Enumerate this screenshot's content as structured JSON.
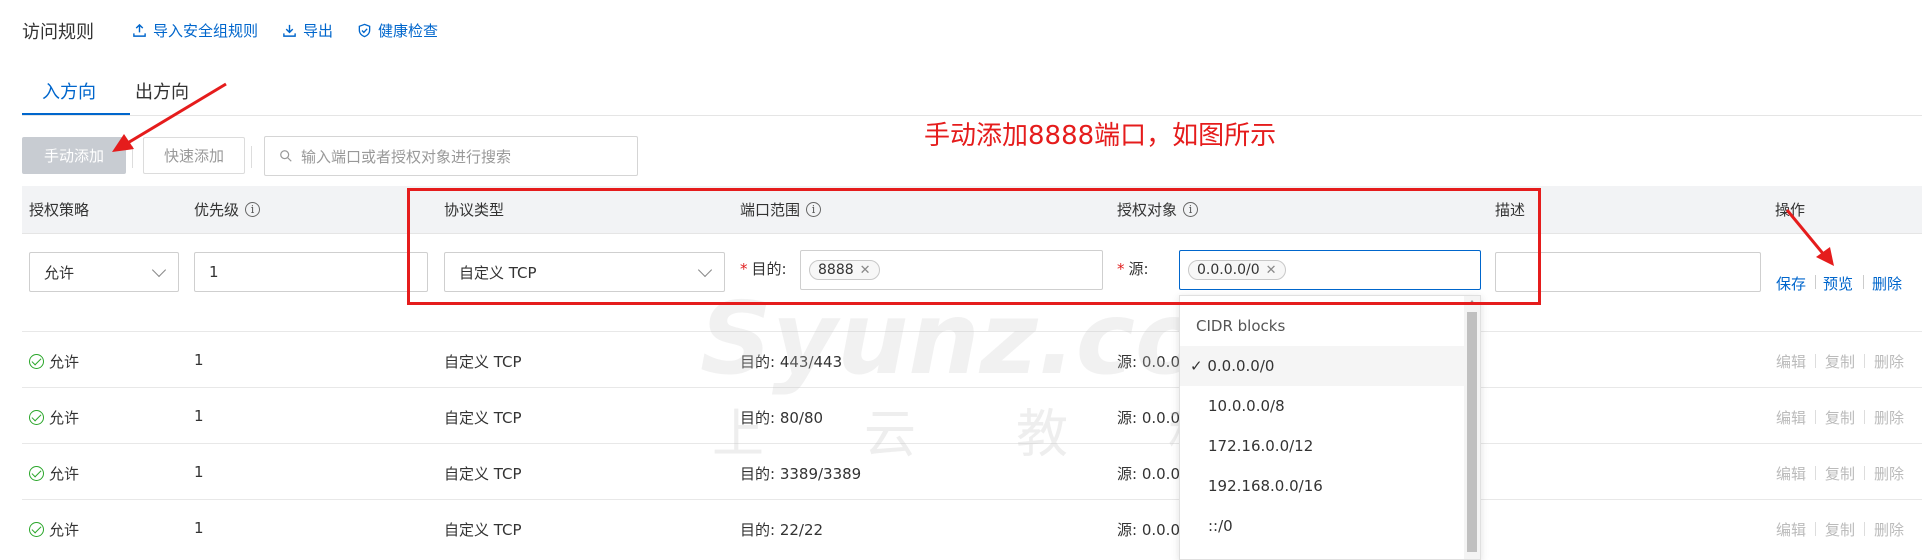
{
  "header": {
    "title": "访问规则",
    "links": [
      {
        "label": "导入安全组规则",
        "icon": "upload-icon"
      },
      {
        "label": "导出",
        "icon": "download-icon"
      },
      {
        "label": "健康检查",
        "icon": "shield-check-icon"
      }
    ]
  },
  "tabs": [
    {
      "label": "入方向",
      "active": true
    },
    {
      "label": "出方向",
      "active": false
    }
  ],
  "toolbar": {
    "manual_add": "手动添加",
    "quick_add": "快速添加",
    "search_placeholder": "输入端口或者授权对象进行搜索"
  },
  "annotation": "手动添加8888端口，如图所示",
  "watermark": {
    "line1": "Syunz.com",
    "line2": "上云教程"
  },
  "table": {
    "headers": {
      "policy": "授权策略",
      "priority": "优先级",
      "protocol": "协议类型",
      "port_range": "端口范围",
      "auth_object": "授权对象",
      "description": "描述",
      "actions": "操作"
    },
    "edit_row": {
      "policy": "允许",
      "priority": "1",
      "protocol": "自定义 TCP",
      "port_label": "目的:",
      "port_tag": "8888",
      "source_label": "源:",
      "source_tag": "0.0.0.0/0",
      "description": "",
      "actions": [
        "保存",
        "预览",
        "删除"
      ]
    },
    "rows": [
      {
        "policy": "允许",
        "priority": "1",
        "protocol": "自定义 TCP",
        "port": "目的: 443/443",
        "source": "源: 0.0.0."
      },
      {
        "policy": "允许",
        "priority": "1",
        "protocol": "自定义 TCP",
        "port": "目的: 80/80",
        "source": "源: 0.0.0."
      },
      {
        "policy": "允许",
        "priority": "1",
        "protocol": "自定义 TCP",
        "port": "目的: 3389/3389",
        "source": "源: 0.0.0."
      },
      {
        "policy": "允许",
        "priority": "1",
        "protocol": "自定义 TCP",
        "port": "目的: 22/22",
        "source": "源: 0.0.0."
      }
    ],
    "row_actions": [
      "编辑",
      "复制",
      "删除"
    ]
  },
  "dropdown": {
    "header": "CIDR blocks",
    "selected": "✓ 0.0.0.0/0",
    "options": [
      "10.0.0.0/8",
      "172.16.0.0/12",
      "192.168.0.0/16",
      "::/0"
    ]
  },
  "colors": {
    "link": "#0066cc",
    "annotation": "#e51c1c",
    "allow": "#2aa62a"
  }
}
